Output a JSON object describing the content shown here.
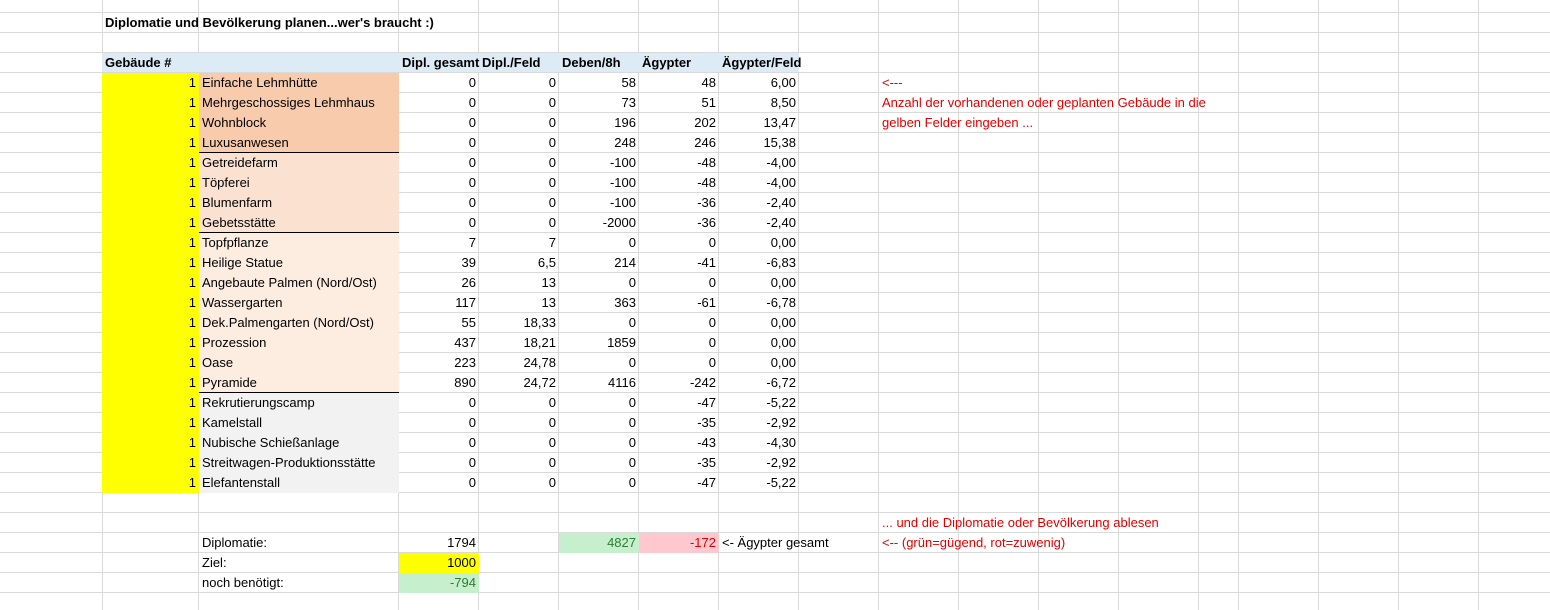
{
  "title": "Diplomatie und Bevölkerung planen...wer's braucht :)",
  "headers": {
    "buildings": "Gebäude #",
    "dipl_total": "Dipl. gesamt",
    "dipl_field": "Dipl./Feld",
    "deben": "Deben/8h",
    "egypt": "Ägypter",
    "egypt_field": "Ägypter/Feld"
  },
  "rows": [
    {
      "count": "1",
      "name": "Einfache Lehmhütte",
      "dipl": "0",
      "dipl_field": "0",
      "deben": "58",
      "egypt": "48",
      "egypt_field": "6,00"
    },
    {
      "count": "1",
      "name": "Mehrgeschossiges Lehmhaus",
      "dipl": "0",
      "dipl_field": "0",
      "deben": "73",
      "egypt": "51",
      "egypt_field": "8,50"
    },
    {
      "count": "1",
      "name": "Wohnblock",
      "dipl": "0",
      "dipl_field": "0",
      "deben": "196",
      "egypt": "202",
      "egypt_field": "13,47"
    },
    {
      "count": "1",
      "name": "Luxusanwesen",
      "dipl": "0",
      "dipl_field": "0",
      "deben": "248",
      "egypt": "246",
      "egypt_field": "15,38"
    },
    {
      "count": "1",
      "name": "Getreidefarm",
      "dipl": "0",
      "dipl_field": "0",
      "deben": "-100",
      "egypt": "-48",
      "egypt_field": "-4,00"
    },
    {
      "count": "1",
      "name": "Töpferei",
      "dipl": "0",
      "dipl_field": "0",
      "deben": "-100",
      "egypt": "-48",
      "egypt_field": "-4,00"
    },
    {
      "count": "1",
      "name": "Blumenfarm",
      "dipl": "0",
      "dipl_field": "0",
      "deben": "-100",
      "egypt": "-36",
      "egypt_field": "-2,40"
    },
    {
      "count": "1",
      "name": "Gebetsstätte",
      "dipl": "0",
      "dipl_field": "0",
      "deben": "-2000",
      "egypt": "-36",
      "egypt_field": "-2,40"
    },
    {
      "count": "1",
      "name": "Topfpflanze",
      "dipl": "7",
      "dipl_field": "7",
      "deben": "0",
      "egypt": "0",
      "egypt_field": "0,00"
    },
    {
      "count": "1",
      "name": "Heilige Statue",
      "dipl": "39",
      "dipl_field": "6,5",
      "deben": "214",
      "egypt": "-41",
      "egypt_field": "-6,83"
    },
    {
      "count": "1",
      "name": "Angebaute Palmen (Nord/Ost)",
      "dipl": "26",
      "dipl_field": "13",
      "deben": "0",
      "egypt": "0",
      "egypt_field": "0,00"
    },
    {
      "count": "1",
      "name": "Wassergarten",
      "dipl": "117",
      "dipl_field": "13",
      "deben": "363",
      "egypt": "-61",
      "egypt_field": "-6,78"
    },
    {
      "count": "1",
      "name": "Dek.Palmengarten  (Nord/Ost)",
      "dipl": "55",
      "dipl_field": "18,33",
      "deben": "0",
      "egypt": "0",
      "egypt_field": "0,00"
    },
    {
      "count": "1",
      "name": "Prozession",
      "dipl": "437",
      "dipl_field": "18,21",
      "deben": "1859",
      "egypt": "0",
      "egypt_field": "0,00"
    },
    {
      "count": "1",
      "name": "Oase",
      "dipl": "223",
      "dipl_field": "24,78",
      "deben": "0",
      "egypt": "0",
      "egypt_field": "0,00"
    },
    {
      "count": "1",
      "name": "Pyramide",
      "dipl": "890",
      "dipl_field": "24,72",
      "deben": "4116",
      "egypt": "-242",
      "egypt_field": "-6,72"
    },
    {
      "count": "1",
      "name": "Rekrutierungscamp",
      "dipl": "0",
      "dipl_field": "0",
      "deben": "0",
      "egypt": "-47",
      "egypt_field": "-5,22"
    },
    {
      "count": "1",
      "name": "Kamelstall",
      "dipl": "0",
      "dipl_field": "0",
      "deben": "0",
      "egypt": "-35",
      "egypt_field": "-2,92"
    },
    {
      "count": "1",
      "name": "Nubische Schießanlage",
      "dipl": "0",
      "dipl_field": "0",
      "deben": "0",
      "egypt": "-43",
      "egypt_field": "-4,30"
    },
    {
      "count": "1",
      "name": "Streitwagen-Produktionsstätte",
      "dipl": "0",
      "dipl_field": "0",
      "deben": "0",
      "egypt": "-35",
      "egypt_field": "-2,92"
    },
    {
      "count": "1",
      "name": "Elefantenstall",
      "dipl": "0",
      "dipl_field": "0",
      "deben": "0",
      "egypt": "-47",
      "egypt_field": "-5,22"
    }
  ],
  "summary": {
    "diplomacy_label": "Diplomatie:",
    "diplomacy_value": "1794",
    "deben_total": "4827",
    "egypt_total": "-172",
    "egypt_total_label": "<- Ägypter gesamt",
    "goal_label": "Ziel:",
    "goal_value": "1000",
    "needed_label": "noch benötigt:",
    "needed_value": "-794"
  },
  "notes": {
    "arrow": "<---",
    "line1": "Anzahl der vorhandenen oder geplanten Gebäude in die",
    "line2": "gelben Felder eingeben ...",
    "line3": "... und die Diplomatie oder Bevölkerung ablesen",
    "line4": "<-- (grün=gügend, rot=zuwenig)"
  },
  "colors": {
    "input_yellow": "#ffff00",
    "header_blue": "#ddebf7",
    "ok_green": "#c6efce",
    "low_red": "#ffc7ce",
    "note_red": "#e00000"
  }
}
